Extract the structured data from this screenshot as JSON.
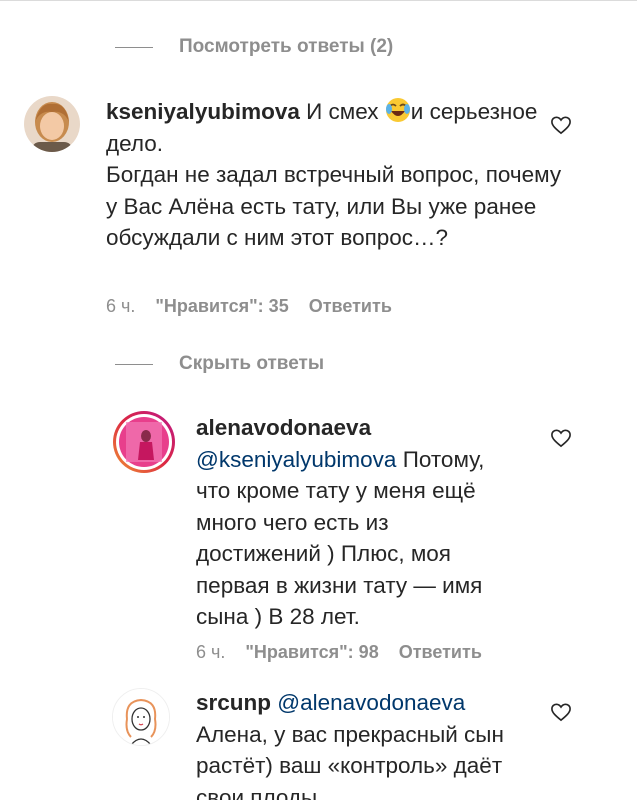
{
  "thread1": {
    "view_replies_label": "Посмотреть ответы (2)"
  },
  "comment1": {
    "username": "kseniyalyubimova",
    "text_part1": " И смех ",
    "emoji": "crying-laughing-emoji",
    "text_part2": "и серьезное дело.",
    "text_line2": "Богдан не задал встречный вопрос, почему у Вас Алёна есть тату, или Вы уже ранее обсуждали с ним этот вопрос…?",
    "time": "6 ч.",
    "likes": "\"Нравится\": 35",
    "reply_label": "Ответить"
  },
  "thread2": {
    "hide_replies_label": "Скрыть ответы"
  },
  "reply1": {
    "username": "alenavodonaeva",
    "mention": "@kseniyalyubimova",
    "text": " Потому, что кроме тату у меня ещё много чего есть из достижений ) Плюс, моя первая в жизни тату — имя сына ) В 28 лет.",
    "time": "6 ч.",
    "likes": "\"Нравится\": 98",
    "reply_label": "Ответить"
  },
  "reply2": {
    "username": "srcunp",
    "mention": "@alenavodonaeva",
    "text": "Алена, у вас прекрасный сын растёт) ваш «контроль» даёт свои плоды"
  },
  "colors": {
    "text": "#262626",
    "secondary": "#8e8e8e",
    "mention": "#00376b",
    "story_ring_start": "#f09433",
    "story_ring_end": "#bc1888"
  }
}
